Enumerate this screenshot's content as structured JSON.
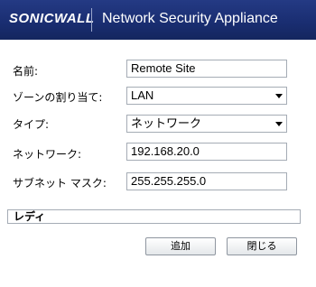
{
  "header": {
    "logo_text": "SONICWALL",
    "title": "Network Security Appliance"
  },
  "form": {
    "name_label": "名前:",
    "name_value": "Remote Site",
    "zone_label": "ゾーンの割り当て:",
    "zone_value": "LAN",
    "type_label": "タイプ:",
    "type_value": "ネットワーク",
    "network_label": "ネットワーク:",
    "network_value": "192.168.20.0",
    "subnet_label": "サブネット マスク:",
    "subnet_value": "255.255.255.0"
  },
  "status": {
    "text": "レディ"
  },
  "buttons": {
    "add_label": "追加",
    "close_label": "閉じる"
  },
  "colors": {
    "header_bg": "#1f3478",
    "header_text": "#ffffff"
  }
}
